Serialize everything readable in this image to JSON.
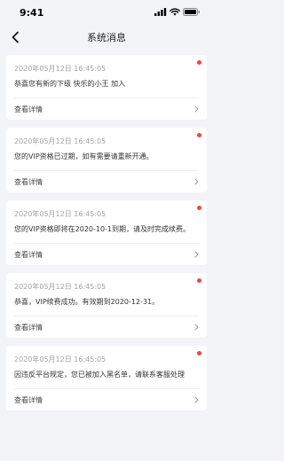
{
  "status_bar": {
    "time": "9:41",
    "icons": [
      "signal-icon",
      "wifi-icon",
      "battery-icon"
    ]
  },
  "nav": {
    "title": "系统消息",
    "back_icon": "back-arrow-icon"
  },
  "colors": {
    "background": "#f3f4f8",
    "card": "#ffffff",
    "unread_dot": "#f2453d",
    "time_text": "#a3a3a3"
  },
  "messages": [
    {
      "time": "2020年05月12日 16:45:05",
      "content": "恭喜您有新的下级 快乐的小王 加入",
      "detail_label": "查看详情",
      "unread": true
    },
    {
      "time": "2020年05月12日 16:45:05",
      "content": "您的VIP资格已过期，如有需要请重新开通。",
      "detail_label": "查看详情",
      "unread": true
    },
    {
      "time": "2020年05月12日 16:45:05",
      "content": "您的VIP资格即将在2020-10-1到期，请及时完成续费。",
      "detail_label": "查看详情",
      "unread": true
    },
    {
      "time": "2020年05月12日 16:45:05",
      "content": "恭喜，VIP续费成功。有效期到2020-12-31。",
      "detail_label": "查看详情",
      "unread": true
    },
    {
      "time": "2020年05月12日 16:45:05",
      "content": "因违反平台规定，您已被加入黑名单，请联系客服处理",
      "detail_label": "查看详情",
      "unread": true
    }
  ]
}
